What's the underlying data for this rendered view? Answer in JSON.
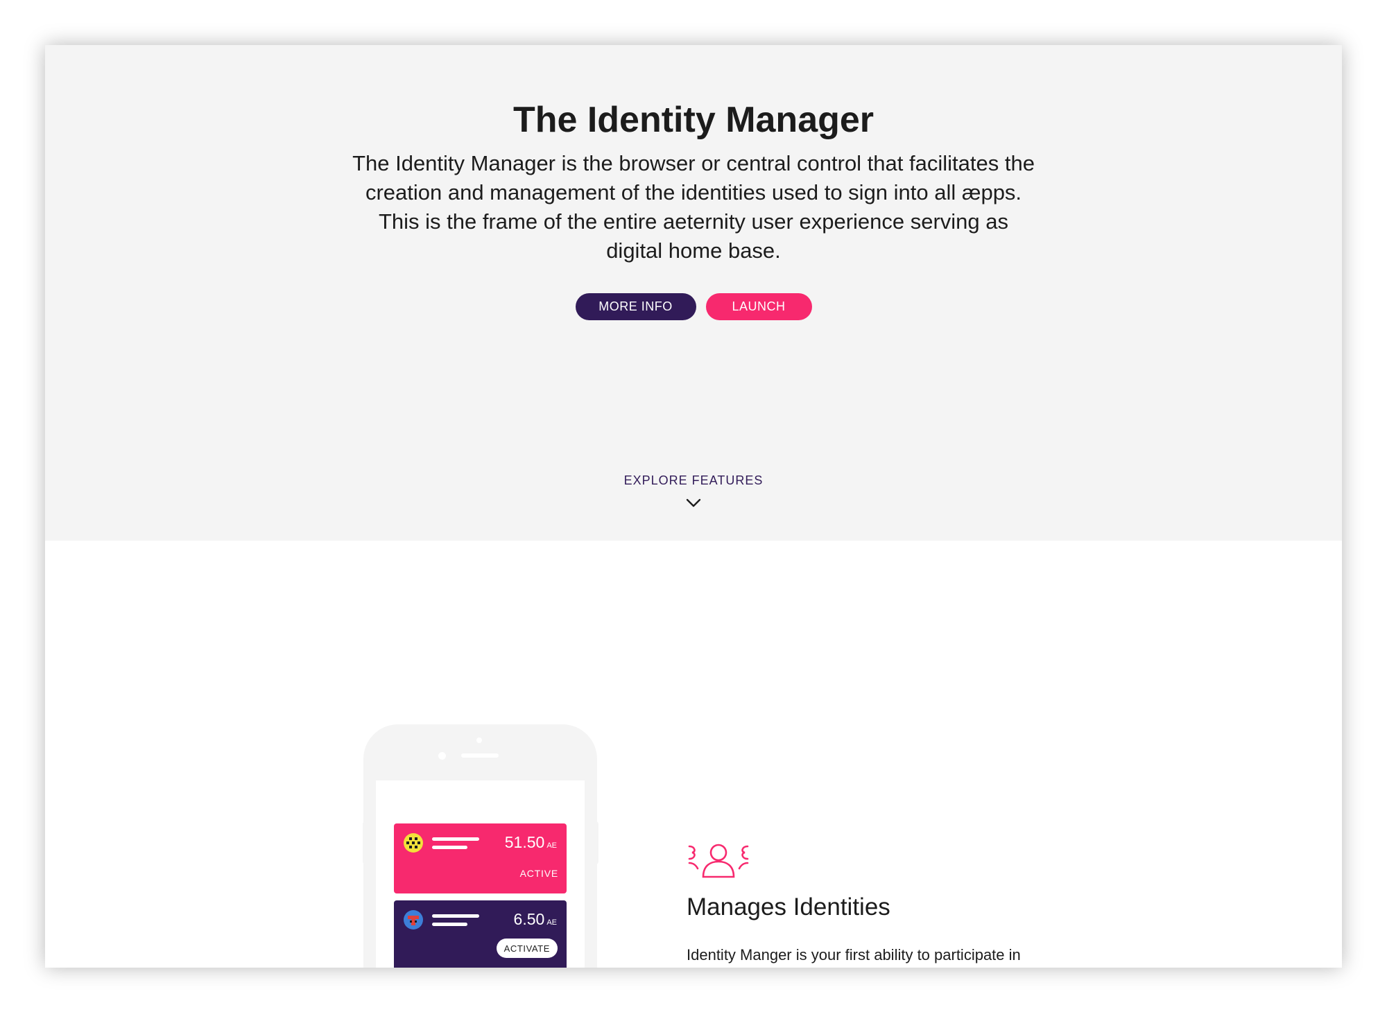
{
  "hero": {
    "title": "The Identity Manager",
    "description": "The Identity Manager is the browser or central control that facilitates the creation and management of the identities used to sign into all æpps. This is the frame of the entire aeternity user experience serving as digital home base.",
    "more_info_label": "MORE INFO",
    "launch_label": "LAUNCH",
    "explore_label": "EXPLORE FEATURES",
    "explore_icon": "chevron-down-icon"
  },
  "phone": {
    "accounts": [
      {
        "amount": "51.50",
        "unit": "AE",
        "status": "ACTIVE",
        "color": "#f7296e"
      },
      {
        "amount": "6.50",
        "unit": "AE",
        "action": "ACTIVATE",
        "color": "#311b58"
      }
    ]
  },
  "feature": {
    "icon": "identities-icon",
    "title": "Manages Identities",
    "text": "Identity Manger is your first ability to participate in and contribute to a world wide decentralized"
  },
  "colors": {
    "primary": "#311b58",
    "accent": "#f7296e",
    "hero_bg": "#f4f4f4"
  }
}
